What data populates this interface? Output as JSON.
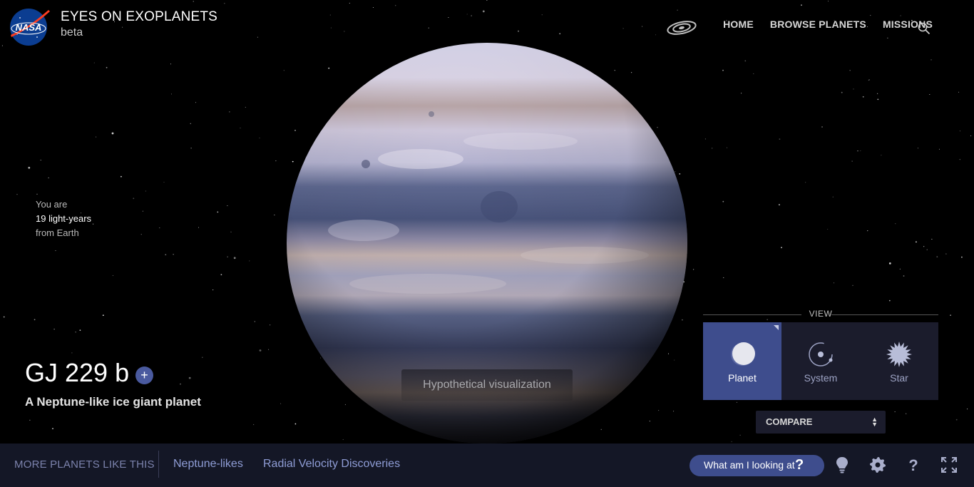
{
  "header": {
    "app_title": "EYES ON EXOPLANETS",
    "app_subtitle": "beta",
    "logo_text": "NASA",
    "nav": [
      {
        "label": "HOME"
      },
      {
        "label": "BROWSE PLANETS"
      },
      {
        "label": "MISSIONS"
      }
    ]
  },
  "distance": {
    "prefix": "You are",
    "value": "19 light-years",
    "suffix": "from Earth"
  },
  "planet": {
    "name": "GJ 229 b",
    "add_symbol": "+",
    "description": "A Neptune-like ice giant planet",
    "visualization_note": "Hypothetical visualization"
  },
  "view": {
    "heading": "VIEW",
    "options": [
      {
        "label": "Planet",
        "icon": "planet-icon",
        "active": true
      },
      {
        "label": "System",
        "icon": "system-icon",
        "active": false
      },
      {
        "label": "Star",
        "icon": "star-icon",
        "active": false
      }
    ],
    "compare": {
      "label": "COMPARE"
    }
  },
  "bottom": {
    "more_label": "MORE PLANETS LIKE THIS",
    "categories": [
      {
        "label": "Neptune-likes"
      },
      {
        "label": "Radial Velocity Discoveries"
      }
    ],
    "looking_label": "What am I looking at",
    "looking_symbol": "?"
  },
  "colors": {
    "accent": "#3e4d8d",
    "panel": "#1b1c2c",
    "bottom_bar": "#141726",
    "link": "#8f9dd6"
  }
}
